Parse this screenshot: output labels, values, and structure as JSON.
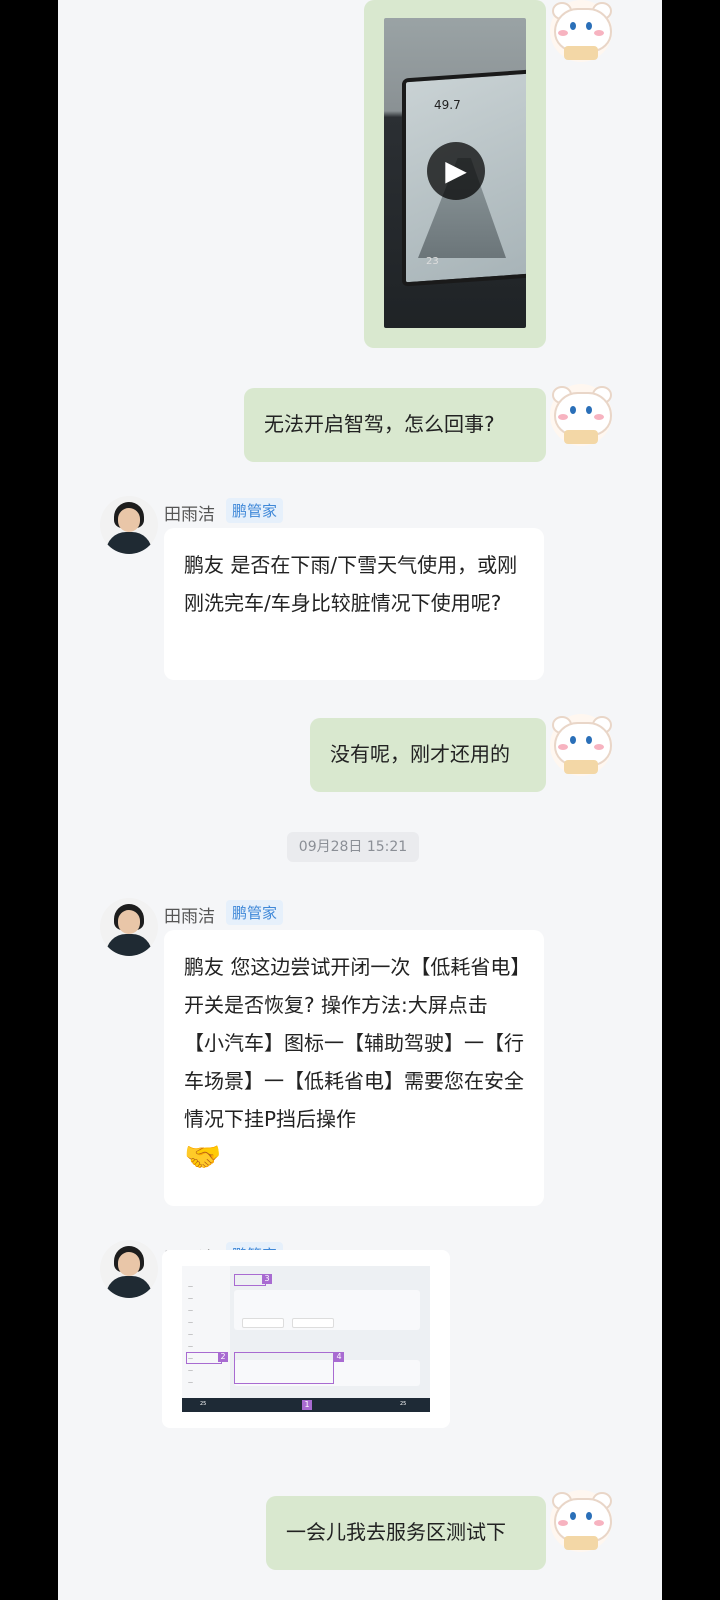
{
  "video": {
    "play_icon": "play-icon",
    "nav_distance": "49.7",
    "speed": "23"
  },
  "messages": [
    {
      "from": "user",
      "text": "无法开启智驾，怎么回事?"
    },
    {
      "from": "agent",
      "name": "田雨洁",
      "badge": "鹏管家",
      "text": "鹏友  是否在下雨/下雪天气使用，或刚刚洗完车/车身比较脏情况下使用呢?"
    },
    {
      "from": "user",
      "text": "没有呢，刚才还用的"
    },
    {
      "from": "agent",
      "name": "田雨洁",
      "badge": "鹏管家",
      "text": "鹏友  您这边尝试开闭一次【低耗省电】开关是否恢复? 操作方法:大屏点击【小汽车】图标一【辅助驾驶】一【行车场景】一【低耗省电】需要您在安全情况下挂P挡后操作",
      "emoji": "🤝"
    },
    {
      "from": "agent",
      "name": "田雨洁",
      "badge": "鹏管家",
      "type": "image"
    },
    {
      "from": "user",
      "text": "一会儿我去服务区测试下"
    }
  ],
  "timestamp": "09月28日 15:21",
  "screenshot": {
    "markers": [
      "1",
      "2",
      "3",
      "4"
    ],
    "speed_left": "25",
    "speed_right": "25"
  }
}
